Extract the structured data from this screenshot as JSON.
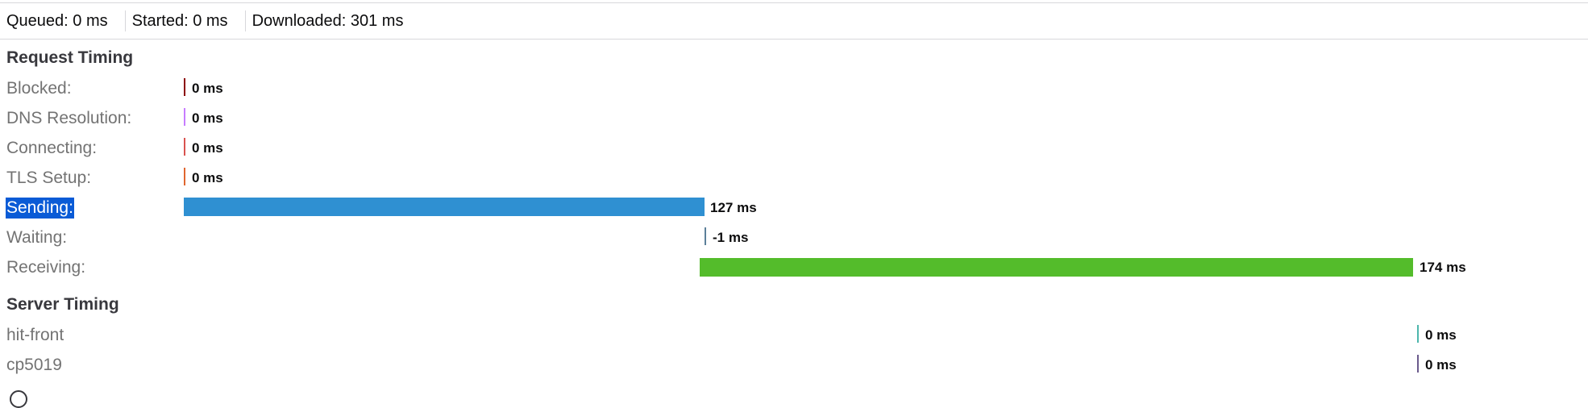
{
  "summary": {
    "queued": "Queued: 0 ms",
    "started": "Started: 0 ms",
    "downloaded": "Downloaded: 301 ms"
  },
  "request_timing": {
    "title": "Request Timing",
    "rows": [
      {
        "label": "Blocked:",
        "value": "0 ms",
        "ms": 0,
        "color": "#8b0000"
      },
      {
        "label": "DNS Resolution:",
        "value": "0 ms",
        "ms": 0,
        "color": "#c77dff"
      },
      {
        "label": "Connecting:",
        "value": "0 ms",
        "ms": 0,
        "color": "#d9534f"
      },
      {
        "label": "TLS Setup:",
        "value": "0 ms",
        "ms": 0,
        "color": "#e0662f"
      },
      {
        "label": "Sending:",
        "value": "127 ms",
        "ms": 127,
        "color": "#2f90d2",
        "selected": true
      },
      {
        "label": "Waiting:",
        "value": "-1 ms",
        "ms": -1,
        "color": "#5b7f99"
      },
      {
        "label": "Receiving:",
        "value": "174 ms",
        "ms": 174,
        "color": "#54bc2b"
      }
    ]
  },
  "server_timing": {
    "title": "Server Timing",
    "rows": [
      {
        "label": "hit-front",
        "value": "0 ms",
        "ms": 0,
        "color": "#4db6ac"
      },
      {
        "label": "cp5019",
        "value": "0 ms",
        "ms": 0,
        "color": "#6a5a8c"
      }
    ]
  },
  "colors": {
    "selection": "#0a5bd6",
    "sending_bar": "#2f90d2",
    "receiving_bar": "#54bc2b"
  }
}
